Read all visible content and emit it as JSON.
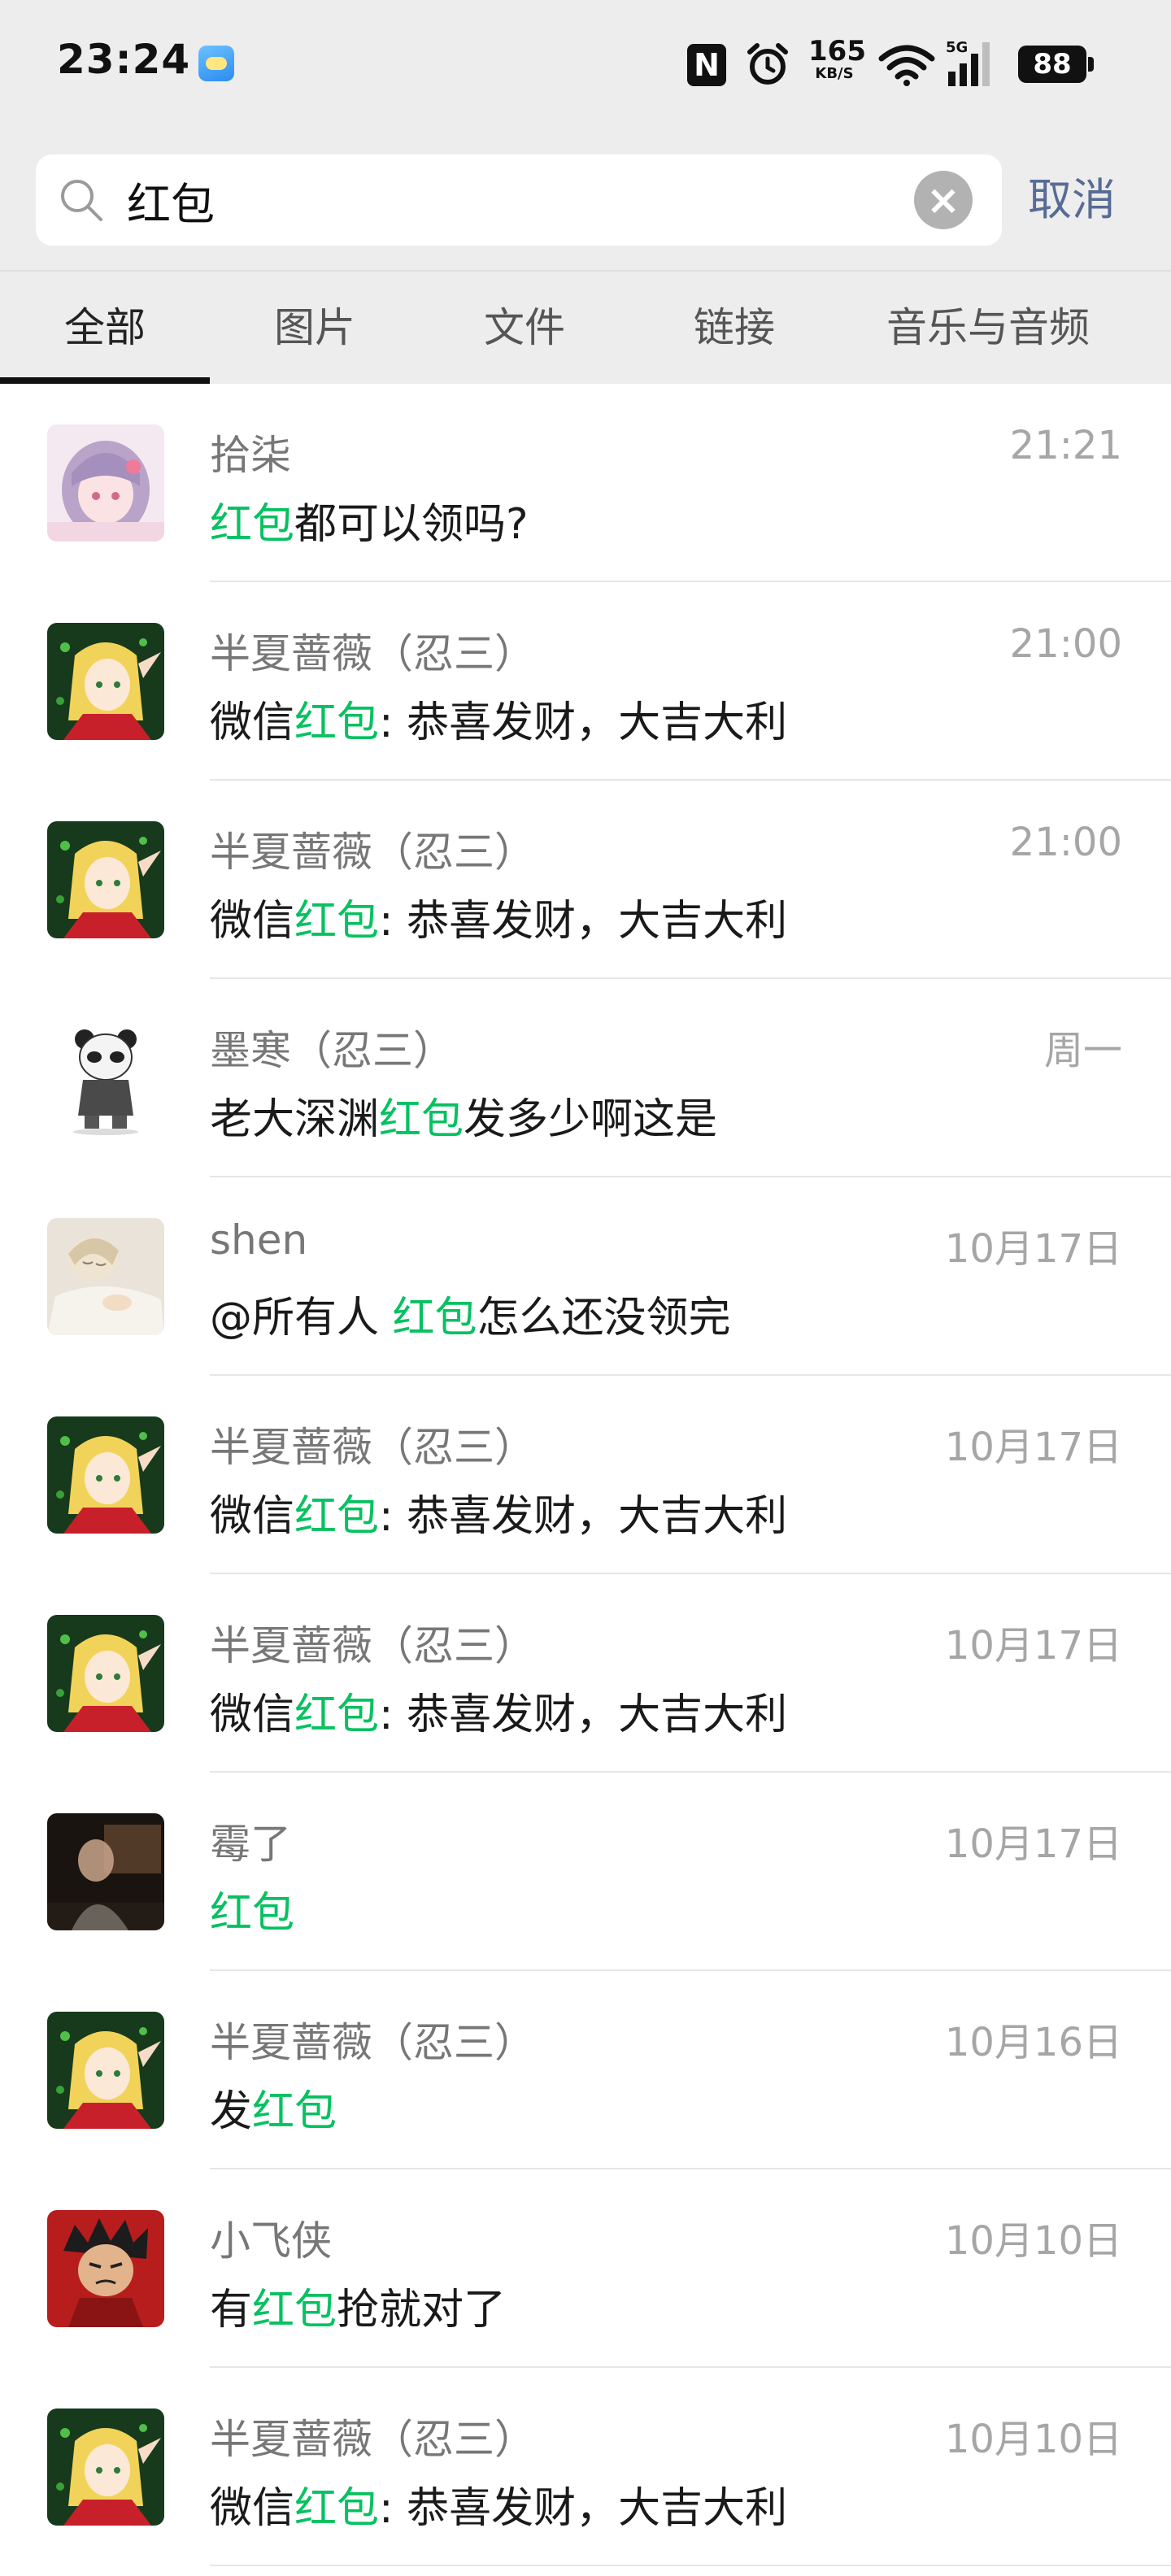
{
  "status_bar": {
    "time": "23:24",
    "nfc": "N",
    "net_speed_value": "165",
    "net_speed_unit": "KB/S",
    "network_type": "5G",
    "battery": "88",
    "icons": [
      "weather-icon",
      "nfc-icon",
      "alarm-icon",
      "wifi-icon",
      "signal-icon",
      "battery-icon"
    ]
  },
  "search": {
    "query": "红包",
    "clear_icon": "close-icon",
    "cancel_label": "取消"
  },
  "tabs": [
    {
      "label": "全部",
      "active": true
    },
    {
      "label": "图片",
      "active": false
    },
    {
      "label": "文件",
      "active": false
    },
    {
      "label": "链接",
      "active": false
    },
    {
      "label": "音乐与音频",
      "active": false
    }
  ],
  "colors": {
    "highlight": "#07c160",
    "cancel": "#576b95",
    "header_bg": "#ededed"
  },
  "results": [
    {
      "sender": "拾柒",
      "time": "21:21",
      "pre": "",
      "hl": "红包",
      "post": "都可以领吗?",
      "avatar": "anime-girl-pink"
    },
    {
      "sender": "半夏蔷薇（忍三）",
      "time": "21:00",
      "pre": "微信",
      "hl": "红包",
      "post": ": 恭喜发财，大吉大利",
      "avatar": "blonde-elf"
    },
    {
      "sender": "半夏蔷薇（忍三）",
      "time": "21:00",
      "pre": "微信",
      "hl": "红包",
      "post": ": 恭喜发财，大吉大利",
      "avatar": "blonde-elf"
    },
    {
      "sender": "墨寒（忍三）",
      "time": "周一",
      "pre": "老大深渊",
      "hl": "红包",
      "post": "发多少啊这是",
      "avatar": "panda"
    },
    {
      "sender": "shen",
      "time": "10月17日",
      "pre": "@所有人 ",
      "hl": "红包",
      "post": "怎么还没领完",
      "avatar": "sleeping-girl"
    },
    {
      "sender": "半夏蔷薇（忍三）",
      "time": "10月17日",
      "pre": "微信",
      "hl": "红包",
      "post": ": 恭喜发财，大吉大利",
      "avatar": "blonde-elf"
    },
    {
      "sender": "半夏蔷薇（忍三）",
      "time": "10月17日",
      "pre": "微信",
      "hl": "红包",
      "post": ": 恭喜发财，大吉大利",
      "avatar": "blonde-elf"
    },
    {
      "sender": "霉了",
      "time": "10月17日",
      "pre": "",
      "hl": "红包",
      "post": "",
      "avatar": "dark-photo"
    },
    {
      "sender": "半夏蔷薇（忍三）",
      "time": "10月16日",
      "pre": "发",
      "hl": "红包",
      "post": "",
      "avatar": "blonde-elf"
    },
    {
      "sender": "小飞侠",
      "time": "10月10日",
      "pre": "有",
      "hl": "红包",
      "post": "抢就对了",
      "avatar": "red-cartoon"
    },
    {
      "sender": "半夏蔷薇（忍三）",
      "time": "10月10日",
      "pre": "微信",
      "hl": "红包",
      "post": ": 恭喜发财，大吉大利",
      "avatar": "blonde-elf"
    }
  ]
}
